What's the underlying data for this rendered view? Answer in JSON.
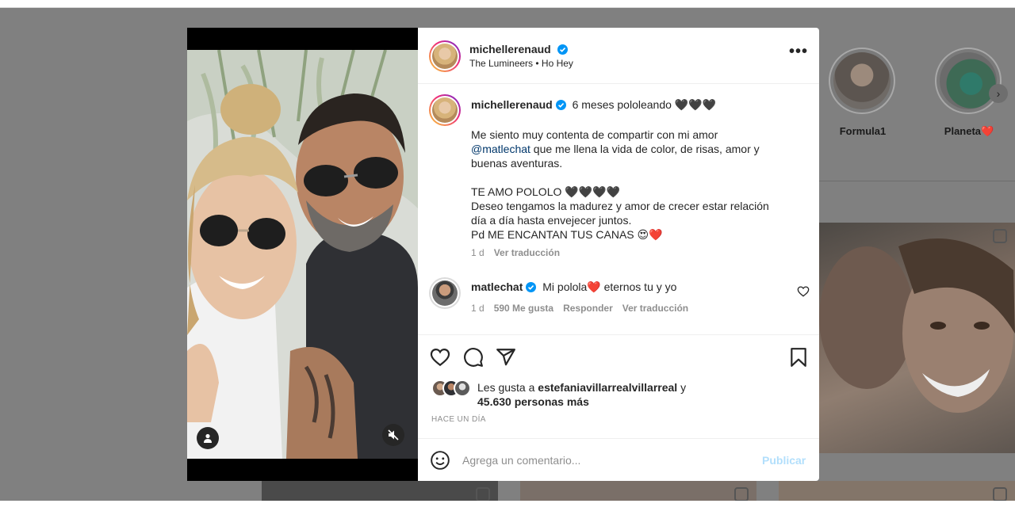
{
  "colors": {
    "overlay": "#808080",
    "link": "#00376b",
    "publish_disabled": "#b2dffc",
    "verified": "#0095f6",
    "heart_red": "#ed4956"
  },
  "background": {
    "stories": [
      {
        "label": "Formula1",
        "icon": "story-avatar"
      },
      {
        "label": "Planeta❤️",
        "icon": "story-avatar"
      }
    ]
  },
  "post": {
    "header": {
      "username": "michellerenaud",
      "verified": true,
      "song": "The Lumineers • Ho Hey",
      "more_icon": "more-options-icon",
      "more_label": "•••"
    },
    "caption": {
      "username": "michellerenaud",
      "first_line": "6 meses pololeando 🖤🖤🖤",
      "line1": "Me siento muy contenta de compartir con mi amor",
      "mention": "@matlechat",
      "line2_rest": " que me llena la vida de color, de risas, amor y",
      "line3": "buenas aventuras.",
      "line4": "TE AMO POLOLO 🖤🖤🖤🖤",
      "line5": "Deseo tengamos la madurez y amor de crecer estar relación",
      "line6": "día a día hasta envejecer juntos.",
      "line7": "Pd ME ENCANTAN TUS CANAS 😍❤️",
      "time": "1 d",
      "translate": "Ver traducción"
    },
    "comment": {
      "username": "matlechat",
      "verified": true,
      "text": "Mi polola❤️ eternos tu y yo",
      "time": "1 d",
      "likes": "590 Me gusta",
      "reply": "Responder",
      "translate": "Ver traducción"
    },
    "actions": {
      "like_icon": "heart-icon",
      "comment_icon": "comment-icon",
      "share_icon": "share-icon",
      "save_icon": "bookmark-icon"
    },
    "likes": {
      "prefix": "Les gusta a ",
      "user": "estefaniavillarrealvillarreal",
      "suffix": " y",
      "others": "45.630 personas más"
    },
    "posted_ago": "HACE UN DÍA",
    "comment_input": {
      "placeholder": "Agrega un comentario...",
      "value": "",
      "publish_label": "Publicar"
    }
  }
}
